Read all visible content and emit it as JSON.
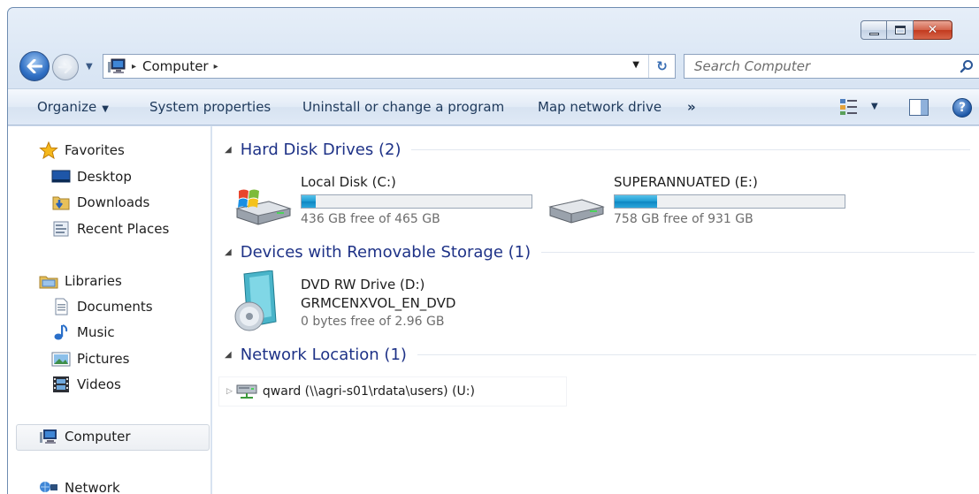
{
  "window": {
    "caption_min": "–",
    "caption_max": "□",
    "caption_close": "✕"
  },
  "nav": {
    "back_glyph": "◀",
    "forward_glyph": "▶",
    "history_drop": "▼"
  },
  "address": {
    "crumb_sep": "▸",
    "crumb": "Computer",
    "drop": "▼",
    "refresh": "↻"
  },
  "search": {
    "placeholder": "Search Computer"
  },
  "commandbar": {
    "organize": "Organize",
    "organize_caret": "▼",
    "system_properties": "System properties",
    "uninstall": "Uninstall or change a program",
    "map_drive": "Map network drive",
    "more": "»",
    "view_caret": "▼",
    "help": "?"
  },
  "sidebar": {
    "favorites": "Favorites",
    "favorites_items": [
      "Desktop",
      "Downloads",
      "Recent Places"
    ],
    "libraries": "Libraries",
    "libraries_items": [
      "Documents",
      "Music",
      "Pictures",
      "Videos"
    ],
    "computer": "Computer",
    "network": "Network"
  },
  "groups": {
    "hard_disks": "Hard Disk Drives (2)",
    "removable": "Devices with Removable Storage (1)",
    "network": "Network Location (1)",
    "collapse_glyph": "◢"
  },
  "drives": [
    {
      "name": "Local Disk (C:)",
      "free": "436 GB free of 465 GB",
      "used_fraction": 0.062
    },
    {
      "name": "SUPERANNUATED (E:)",
      "free": "758 GB free of 931 GB",
      "used_fraction": 0.186
    }
  ],
  "removable": {
    "name": "DVD RW Drive (D:)",
    "label": "GRMCENXVOL_EN_DVD",
    "free": "0 bytes free of 2.96 GB"
  },
  "network_location": {
    "expand_glyph": "▷",
    "label": "qward (\\\\agri-s01\\rdata\\users) (U:)"
  }
}
